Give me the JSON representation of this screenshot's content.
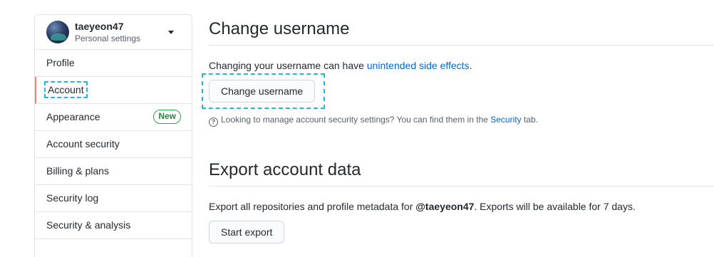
{
  "sidebar": {
    "username": "taeyeon47",
    "subtitle": "Personal settings",
    "items": [
      {
        "label": "Profile"
      },
      {
        "label": "Account"
      },
      {
        "label": "Appearance",
        "badge": "New"
      },
      {
        "label": "Account security"
      },
      {
        "label": "Billing & plans"
      },
      {
        "label": "Security log"
      },
      {
        "label": "Security & analysis"
      }
    ]
  },
  "change_username": {
    "title": "Change username",
    "text_before": "Changing your username can have ",
    "link": "unintended side effects",
    "text_after": ".",
    "button": "Change username",
    "note_before": "Looking to manage account security settings? You can find them in the ",
    "note_link": "Security",
    "note_after": " tab."
  },
  "export": {
    "title": "Export account data",
    "text_before": "Export all repositories and profile metadata for ",
    "handle": "@taeyeon47",
    "text_after": ". Exports will be available for 7 days.",
    "button": "Start export"
  },
  "colors": {
    "accent_link": "#0366d6",
    "selected_border": "#f9826c",
    "badge_green": "#28a745",
    "highlight": "#24b6df"
  }
}
